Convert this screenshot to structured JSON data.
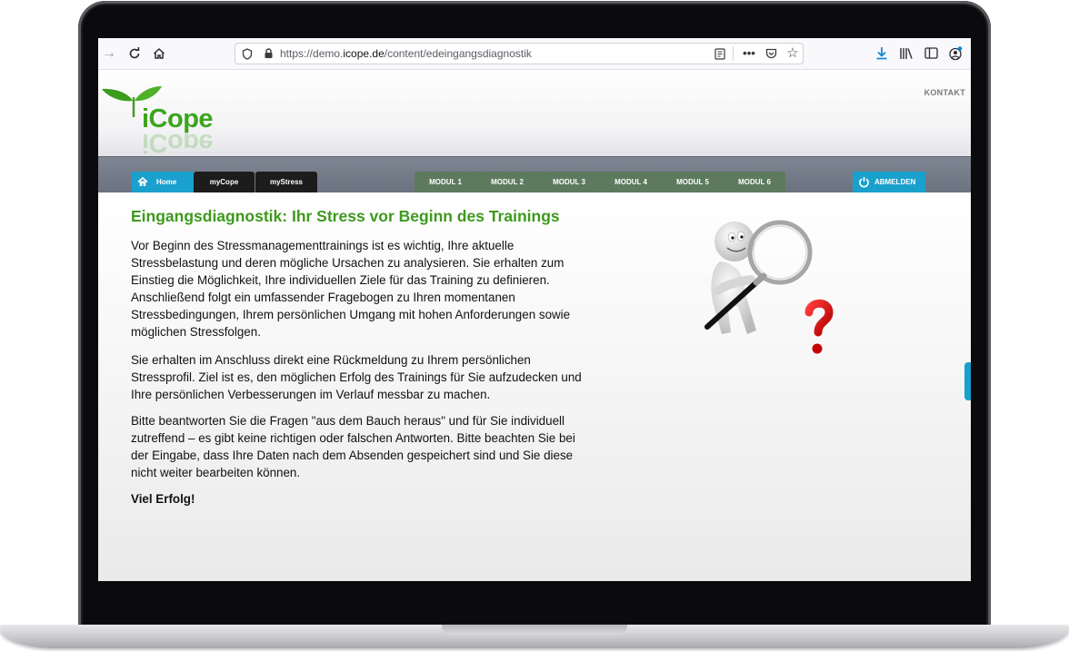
{
  "browser": {
    "url_prefix": "https://demo.",
    "url_domain": "icope.de",
    "url_path": "/content/edeingangsdiagnostik"
  },
  "site": {
    "logo_text": "iCope",
    "header_link": "KONTAKT",
    "nav": {
      "home": "Home",
      "mycope": "myCope",
      "mystress": "myStress",
      "modules": [
        "MODUL 1",
        "MODUL 2",
        "MODUL 3",
        "MODUL 4",
        "MODUL 5",
        "MODUL 6"
      ],
      "logout": "ABMELDEN"
    },
    "page_title": "Eingangsdiagnostik: Ihr Stress vor Beginn des Trainings",
    "paragraphs": [
      "Vor Beginn des Stressmanagementtrainings ist es wichtig, Ihre aktuelle Stressbelastung und deren mögliche Ursachen zu analysieren. Sie erhalten zum Einstieg die Möglichkeit, Ihre individuellen Ziele für das Training zu definieren. Anschließend folgt ein umfassender Fragebogen zu Ihren momentanen Stressbedingungen, Ihrem persönlichen Umgang mit hohen Anforderungen sowie möglichen Stressfolgen.",
      "Sie erhalten im Anschluss direkt eine Rückmeldung zu Ihrem persönlichen Stressprofil. Ziel ist es, den möglichen Erfolg des Trainings für Sie aufzudecken und Ihre persönlichen Verbesserungen im Verlauf messbar zu machen.",
      "Bitte beantworten Sie die Fragen \"aus dem Bauch heraus\" und für Sie individuell zutreffend – es gibt keine richtigen oder falschen Antworten. Bitte beachten Sie bei der Eingabe, dass Ihre Daten nach dem Absenden gespeichert sind und Sie diese nicht weiter bearbeiten können."
    ],
    "closing": "Viel Erfolg!"
  },
  "colors": {
    "brand_green": "#3aa51d",
    "nav_blue": "#1aa0cd",
    "nav_module_green": "#5d7a5e",
    "nav_dark": "#1c1c1c"
  },
  "icons": [
    "forward-icon",
    "reload-icon",
    "home-icon",
    "shield-icon",
    "lock-icon",
    "reader-icon",
    "more-icon",
    "pocket-icon",
    "star-icon",
    "download-icon",
    "library-icon",
    "sidebar-icon",
    "account-icon",
    "power-icon"
  ]
}
